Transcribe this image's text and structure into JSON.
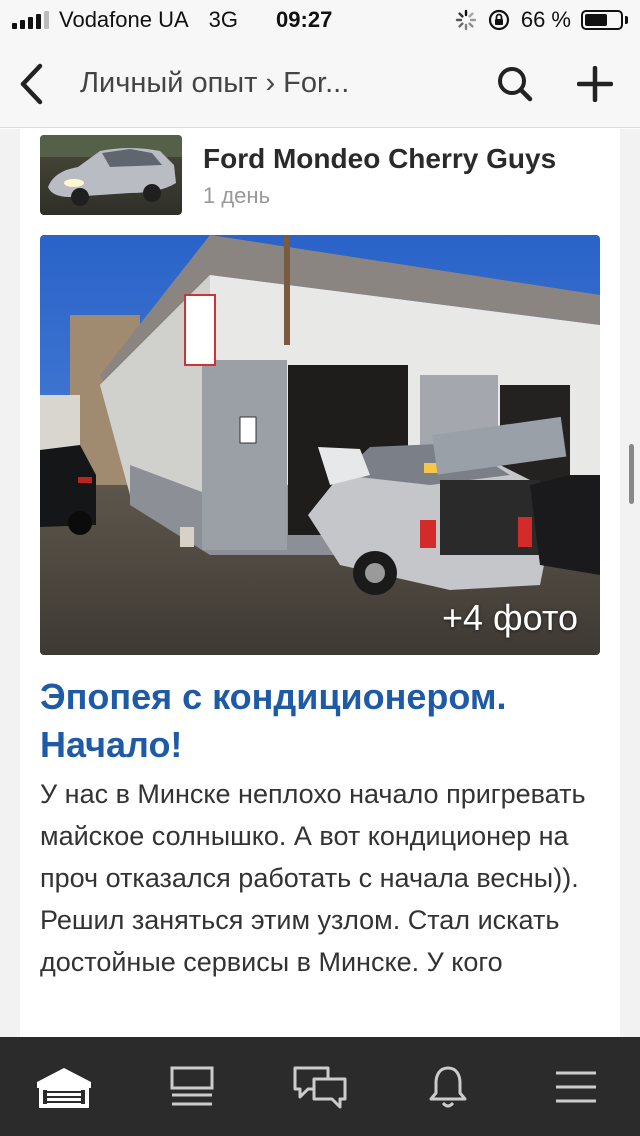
{
  "status": {
    "carrier": "Vodafone UA",
    "network": "3G",
    "time": "09:27",
    "battery_text": "66 %",
    "battery_level": 0.66
  },
  "nav": {
    "title": "Личный опыт › For...",
    "back_icon": "chevron-left-icon",
    "search_icon": "search-icon",
    "add_icon": "plus-icon"
  },
  "post": {
    "author": "Ford Mondeo Cherry Guys",
    "time_ago": "1 день",
    "photo_count": "+4 фото",
    "title": "Эпопея с кондиционером. Начало!",
    "text": "У нас в Минске неплохо начало пригревать майское солнышко. А вот кондиционер на проч отказался работать с начала весны)). Решил заняться этим узлом. Стал искать достойные сервисы в Минске. У кого"
  },
  "tabs": [
    {
      "icon": "garage-icon",
      "active": true
    },
    {
      "icon": "feed-icon",
      "active": false
    },
    {
      "icon": "messages-icon",
      "active": false
    },
    {
      "icon": "bell-icon",
      "active": false
    },
    {
      "icon": "menu-icon",
      "active": false
    }
  ],
  "colors": {
    "title_blue": "#1f5aa6",
    "tab_bar": "#2b2b2b"
  }
}
